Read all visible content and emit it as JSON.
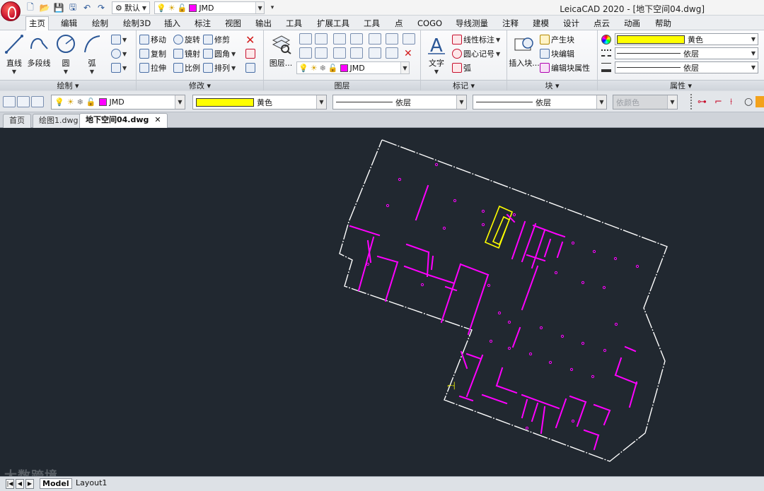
{
  "title_bar": {
    "app_title": "LeicaCAD 2020 - [地下空间04.dwg]",
    "workspace": "默认",
    "layer": "JMD"
  },
  "menu_tabs": [
    {
      "label": "主页",
      "active": true
    },
    {
      "label": "编辑"
    },
    {
      "label": "绘制"
    },
    {
      "label": "绘制3D"
    },
    {
      "label": "插入"
    },
    {
      "label": "标注"
    },
    {
      "label": "视图"
    },
    {
      "label": "输出"
    },
    {
      "label": "工具"
    },
    {
      "label": "扩展工具"
    },
    {
      "label": "工具"
    },
    {
      "label": "点"
    },
    {
      "label": "COGO"
    },
    {
      "label": "导线测量"
    },
    {
      "label": "注释"
    },
    {
      "label": "建模"
    },
    {
      "label": "设计"
    },
    {
      "label": "点云"
    },
    {
      "label": "动画"
    },
    {
      "label": "帮助"
    }
  ],
  "ribbon": {
    "draw": {
      "title": "绘制",
      "tools": [
        "直线",
        "多段线",
        "圆",
        "弧"
      ]
    },
    "modify": {
      "title": "修改",
      "tools": [
        "移动",
        "旋转",
        "修剪",
        "复制",
        "镜射",
        "圆角",
        "拉伸",
        "比例",
        "排列"
      ]
    },
    "layers": {
      "title": "图层",
      "big_tool": "图层...",
      "layer_name": "JMD"
    },
    "annotate": {
      "title": "标记",
      "big_tool": "文字",
      "tools": [
        "线性标注",
        "圆心记号",
        "弧"
      ]
    },
    "block": {
      "title": "块",
      "big_tool": "插入块...",
      "tools": [
        "产生块",
        "块编辑",
        "编辑块属性"
      ]
    },
    "properties": {
      "title": "属性",
      "color": "黄色",
      "linetype": "依层",
      "lineweight": "依层"
    }
  },
  "properties_row": {
    "layer": "JMD",
    "color": "黄色",
    "linetype": "依层",
    "lineweight": "依层",
    "plotstyle": "依颜色"
  },
  "doc_tabs": [
    {
      "label": "首页"
    },
    {
      "label": "绘图1.dwg"
    },
    {
      "label": "地下空间04.dwg",
      "active": true
    }
  ],
  "layout_tabs": [
    {
      "label": "Model",
      "active": true
    },
    {
      "label": "Layout1"
    }
  ],
  "watermark": "大数跨境",
  "colors": {
    "canvas": "#212830",
    "outline": "#ffffff",
    "walls": "#ff00ff",
    "highlight": "#ffff00"
  }
}
